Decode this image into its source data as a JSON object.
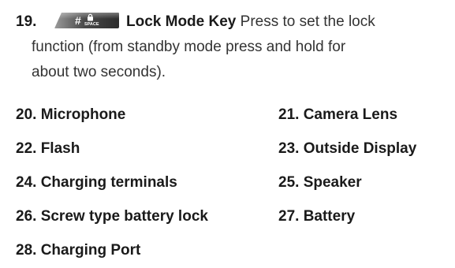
{
  "item19": {
    "number": "19.",
    "key_glyph": "#",
    "key_subtext": "SPACE",
    "key_icon": "lock-icon",
    "title": "Lock Mode Key",
    "desc_line1": " Press to set the lock",
    "desc_line2": "function (from standby mode press and hold for",
    "desc_line3": "about two seconds)."
  },
  "parts": [
    {
      "label": "20. Microphone"
    },
    {
      "label": "21. Camera Lens"
    },
    {
      "label": "22. Flash"
    },
    {
      "label": "23. Outside Display"
    },
    {
      "label": "24. Charging terminals"
    },
    {
      "label": "25. Speaker"
    },
    {
      "label": "26. Screw type battery lock"
    },
    {
      "label": "27. Battery"
    },
    {
      "label": "28. Charging Port"
    }
  ],
  "colors": {
    "key_dark": "#3a3a3a",
    "key_light": "#8a8a8a",
    "text": "#222222"
  }
}
